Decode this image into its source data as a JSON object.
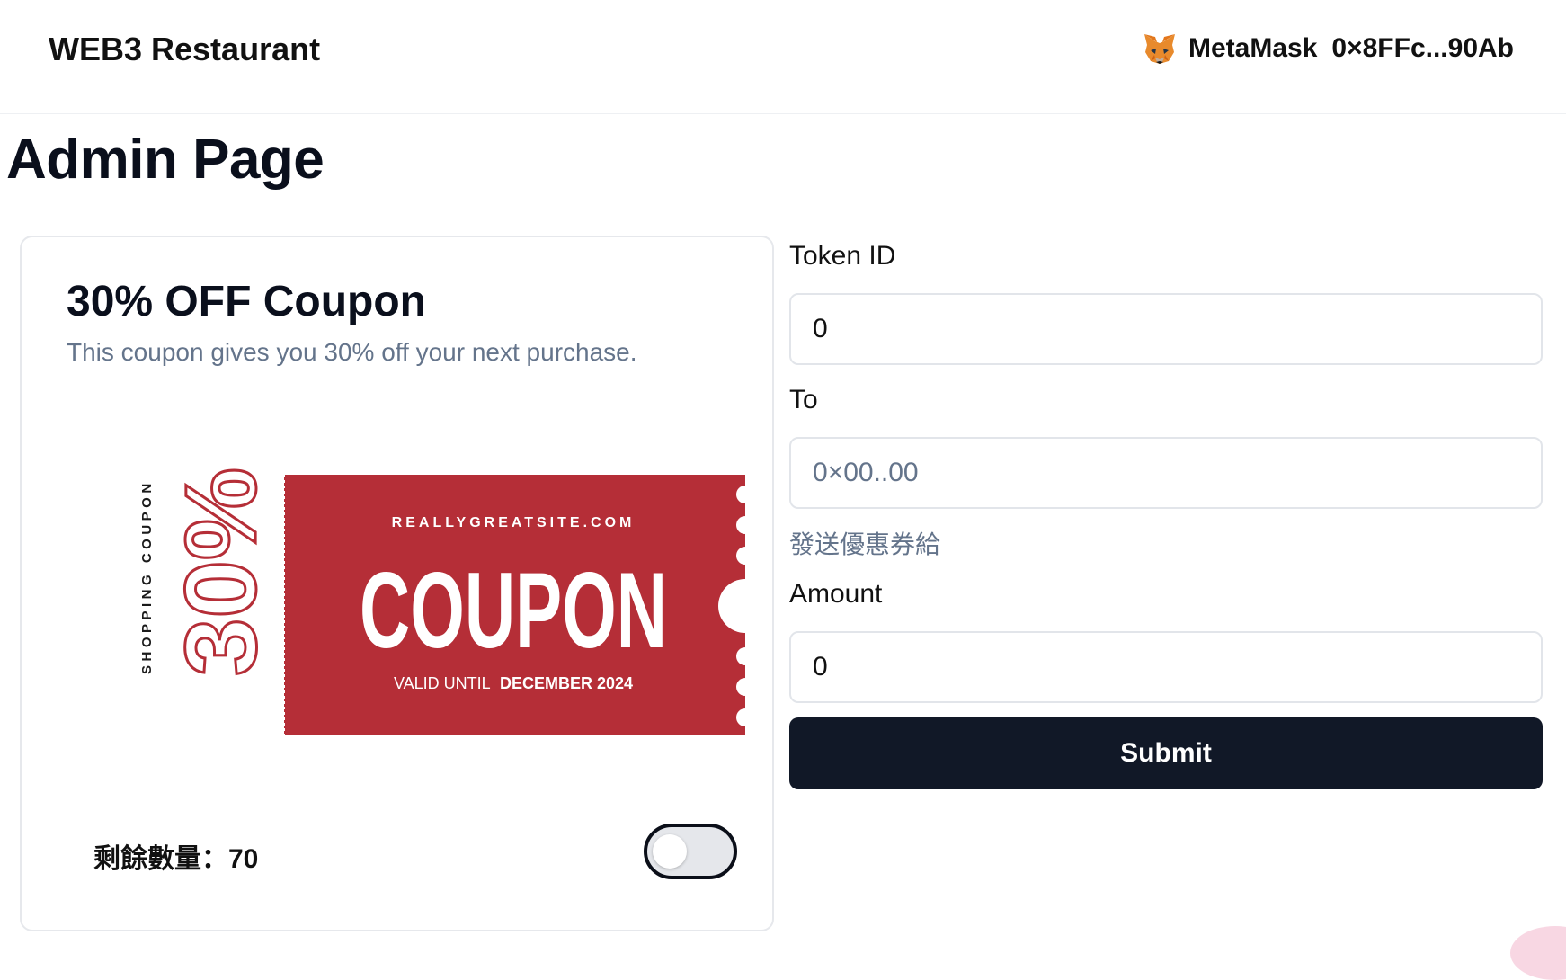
{
  "header": {
    "brand": "WEB3 Restaurant",
    "wallet_name": "MetaMask",
    "wallet_address": "0×8FFc...90Ab",
    "wallet_icon": "metamask-fox-icon"
  },
  "page": {
    "title": "Admin Page"
  },
  "coupon_card": {
    "title": "30% OFF Coupon",
    "description": "This coupon gives you 30% off your next purchase.",
    "image": {
      "side_text": "SHOPPING COUPON",
      "percent": "30%",
      "site": "REALLYGREATSITE.COM",
      "headline": "COUPON",
      "valid_prefix": "VALID UNTIL",
      "valid_date": "DECEMBER 2024",
      "color": "#b52e37"
    },
    "remaining_label": "剩餘數量：70",
    "toggle_on": false
  },
  "form": {
    "token_id_label": "Token ID",
    "token_id_value": "0",
    "to_label": "To",
    "to_placeholder": "0×00..00",
    "to_helper": "發送優惠券給",
    "amount_label": "Amount",
    "amount_value": "0",
    "submit_label": "Submit"
  },
  "colors": {
    "primary_button": "#111827",
    "muted_text": "#64748b",
    "coupon_red": "#b52e37"
  }
}
